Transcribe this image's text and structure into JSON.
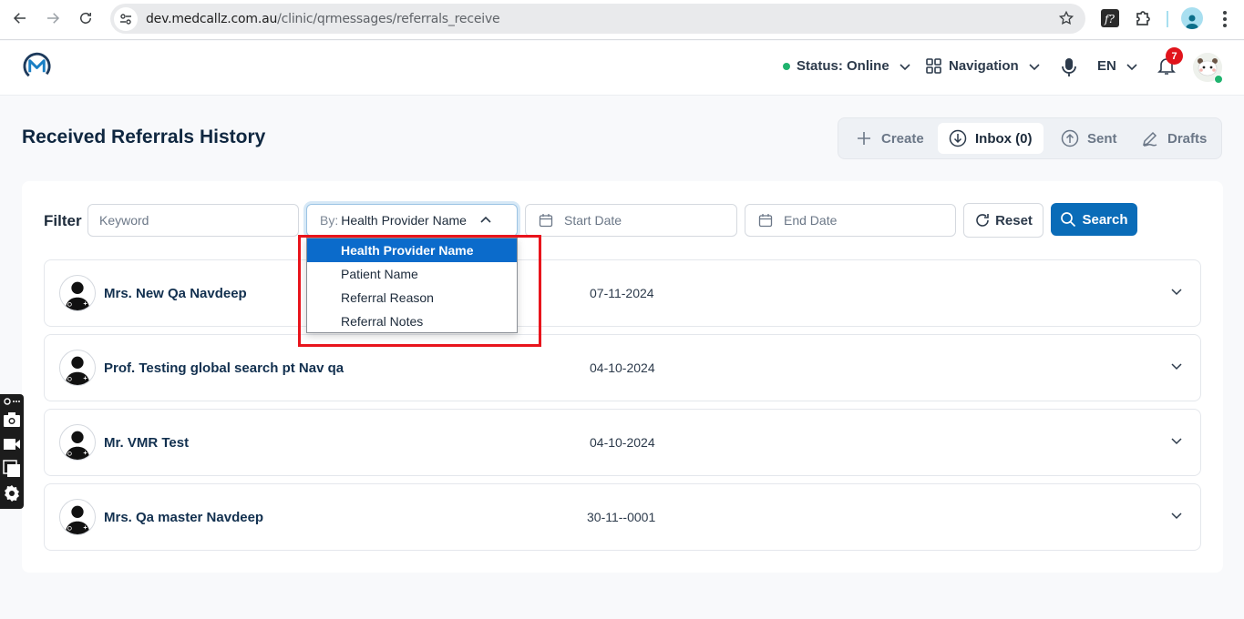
{
  "browser": {
    "url_host": "dev.medcallz.com.au",
    "url_path": "/clinic/qrmessages/referrals_receive"
  },
  "header": {
    "status_label": "Status: Online",
    "status_color": "#1fb36e",
    "navigation_label": "Navigation",
    "language": "EN",
    "notification_count": "7"
  },
  "page": {
    "title": "Received Referrals History"
  },
  "tabs": [
    {
      "label": "Create",
      "icon": "plus-icon"
    },
    {
      "label": "Inbox (0)",
      "icon": "download-icon",
      "active": true
    },
    {
      "label": "Sent",
      "icon": "upload-icon"
    },
    {
      "label": "Drafts",
      "icon": "pen-icon"
    }
  ],
  "filter": {
    "label": "Filter",
    "keyword_placeholder": "Keyword",
    "by_prefix": "By:",
    "by_value": "Health Provider Name",
    "start_date_placeholder": "Start Date",
    "end_date_placeholder": "End Date",
    "reset_label": "Reset",
    "search_label": "Search",
    "accent_color": "#0a6cb8"
  },
  "dropdown": {
    "options": [
      {
        "label": "Health Provider Name",
        "selected": true
      },
      {
        "label": "Patient Name"
      },
      {
        "label": "Referral Reason"
      },
      {
        "label": "Referral Notes"
      }
    ]
  },
  "referrals": [
    {
      "name": "Mrs. New Qa Navdeep",
      "date": "07-11-2024"
    },
    {
      "name": "Prof. Testing global search pt Nav qa",
      "date": "04-10-2024"
    },
    {
      "name": "Mr. VMR Test",
      "date": "04-10-2024"
    },
    {
      "name": "Mrs. Qa master Navdeep",
      "date": "30-11--0001"
    }
  ]
}
